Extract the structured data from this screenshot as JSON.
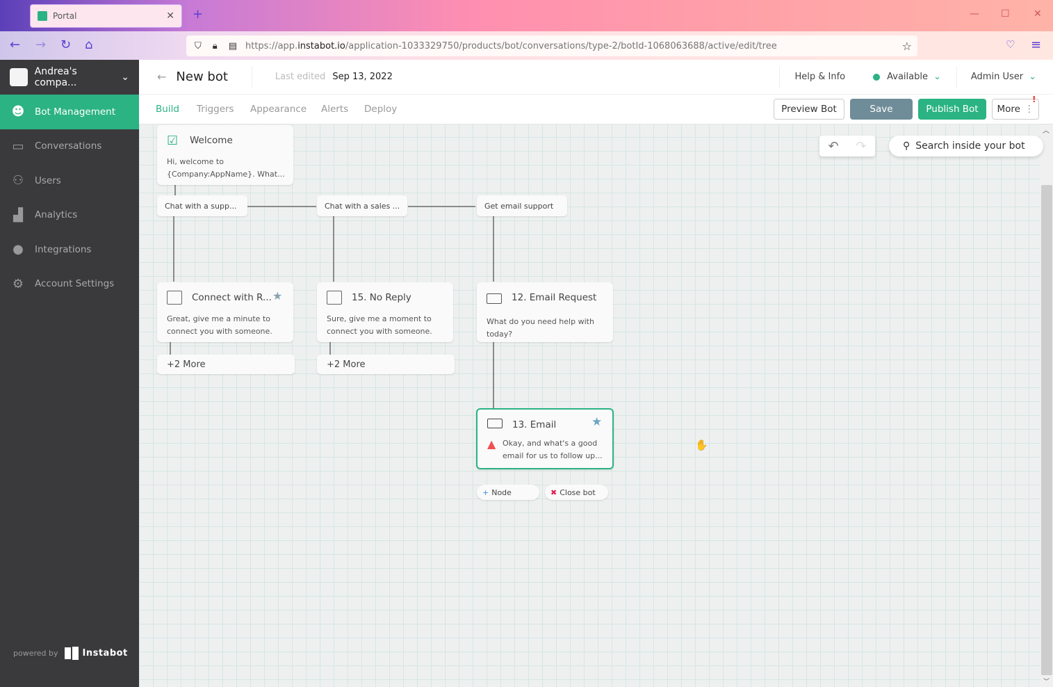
{
  "browser": {
    "tab_title": "Portal",
    "url_prefix": "https://app.",
    "url_host": "instabot.io",
    "url_path": "/application-1033329750/products/bot/conversations/type-2/botId-1068063688/active/edit/tree"
  },
  "sidebar": {
    "company": "Andrea's compa...",
    "items": [
      {
        "label": "Bot Management",
        "icon": "robot-icon",
        "active": true
      },
      {
        "label": "Conversations",
        "icon": "chat-icon"
      },
      {
        "label": "Users",
        "icon": "user-icon"
      },
      {
        "label": "Analytics",
        "icon": "chart-icon"
      },
      {
        "label": "Integrations",
        "icon": "plug-icon"
      },
      {
        "label": "Account Settings",
        "icon": "gear-icon"
      }
    ],
    "powered_by": "powered by",
    "brand": "Instabot"
  },
  "header": {
    "title": "New bot",
    "last_edited_label": "Last edited",
    "last_edited": "Sep 13, 2022",
    "help": "Help & Info",
    "status": "Available",
    "status_color": "#2bb383",
    "user": "Admin User"
  },
  "tabs": [
    "Build",
    "Triggers",
    "Appearance",
    "Alerts",
    "Deploy"
  ],
  "actions": {
    "preview": "Preview Bot",
    "save": "Save",
    "publish": "Publish Bot",
    "more": "More"
  },
  "canvas": {
    "search": "Search inside your bot",
    "nodes": {
      "welcome": {
        "title": "Welcome",
        "body1": "Hi, welcome to",
        "body2": "{Company:AppName}. What..."
      },
      "connect": {
        "title": "Connect with R...",
        "body1": "Great, give me a minute to",
        "body2": "connect you with someone.",
        "more": "+2 More"
      },
      "noreply": {
        "title": "15. No Reply",
        "body1": "Sure, give me a moment to",
        "body2": "connect you with someone.",
        "more": "+2 More"
      },
      "emailreq": {
        "title": "12. Email Request",
        "body1": "What do you need help with",
        "body2": "today?"
      },
      "email": {
        "title": "13. Email",
        "body1": "Okay, and what's a good",
        "body2": "email for us to follow up..."
      }
    },
    "options": [
      "Chat with a supp...",
      "Chat with a sales ...",
      "Get email support"
    ],
    "add_node": "Node",
    "close_bot": "Close bot"
  },
  "colors": {
    "accent": "#2bb383",
    "save": "#6f8c99",
    "sidebar": "#3a3a3c"
  }
}
